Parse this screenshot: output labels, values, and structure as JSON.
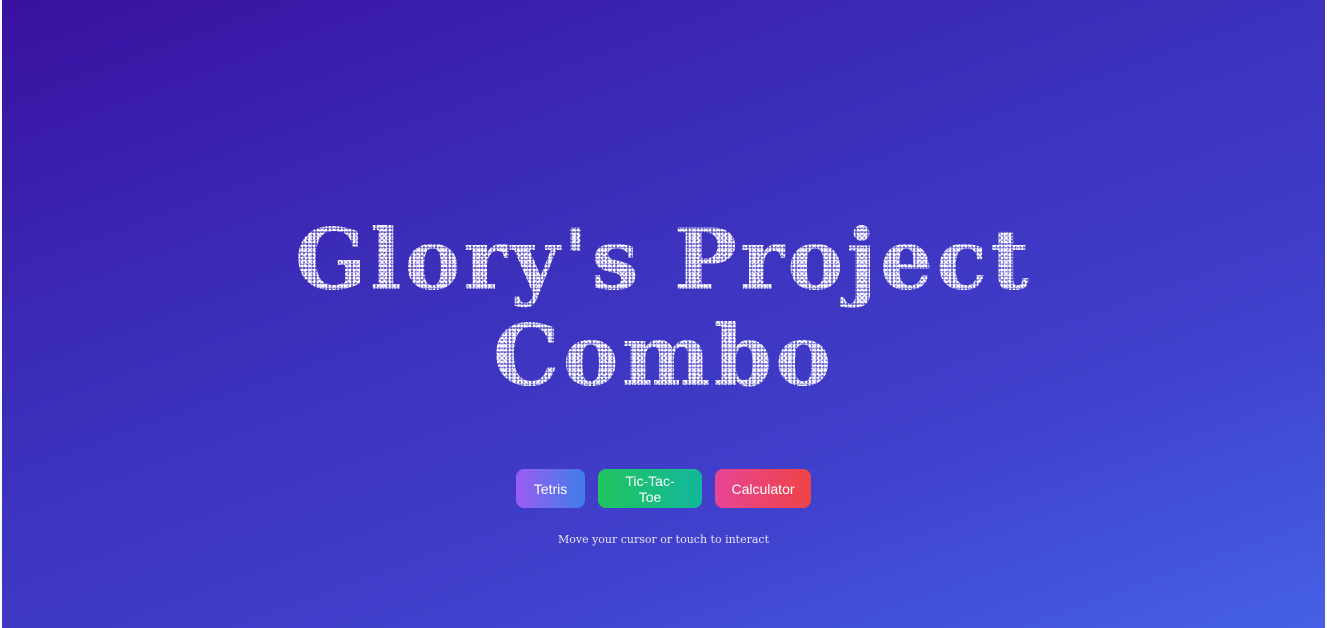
{
  "hero": {
    "title_line1": "Glory's Project",
    "title_line2": "Combo"
  },
  "buttons": {
    "tetris": "Tetris",
    "tictactoe": "Tic-Tac-Toe",
    "calculator": "Calculator"
  },
  "hint": "Move your cursor or touch to interact",
  "colors": {
    "background_start": "#3a11a0",
    "background_end": "#4560e6",
    "tetris_gradient": [
      "#9b5cf2",
      "#3f7ee9"
    ],
    "tictactoe_gradient": [
      "#21c45f",
      "#12b79b"
    ],
    "calculator_gradient": [
      "#e84495",
      "#ee4446"
    ]
  }
}
